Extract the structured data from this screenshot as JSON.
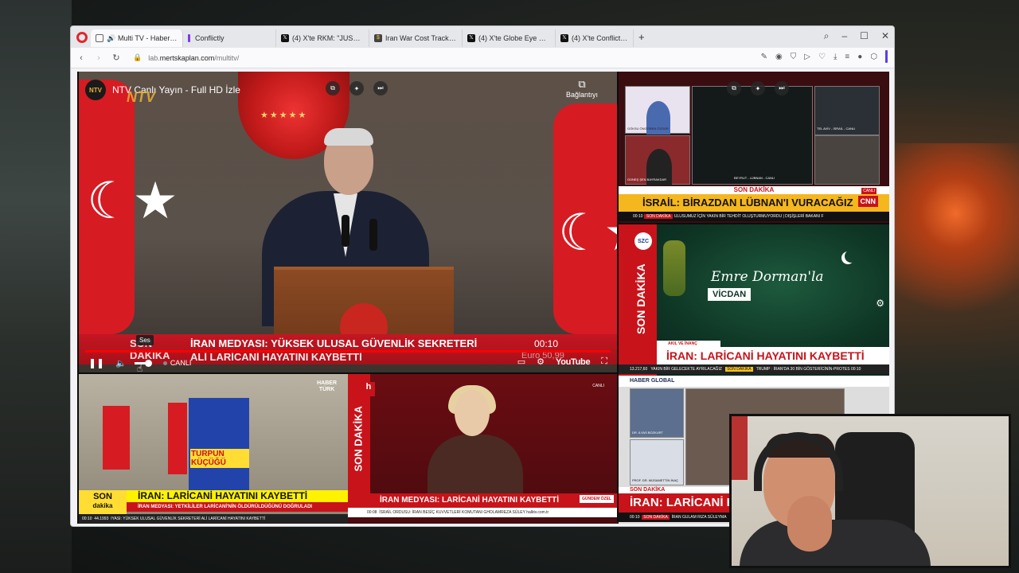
{
  "browser": {
    "tabs": [
      {
        "label": "Multi TV - Haber kanalları",
        "icon": "multitv-icon",
        "active": true
      },
      {
        "label": "Conflictly",
        "icon": "conflictly-icon"
      },
      {
        "label": "(4) X'te RKM: \"JUST IN",
        "icon": "x-icon"
      },
      {
        "label": "Iran War Cost Tracker — I",
        "icon": "tracker-icon"
      },
      {
        "label": "(4) X'te Globe Eye News: \"",
        "icon": "x-icon"
      },
      {
        "label": "(4) X'te Conflict: \"🔴 İsveç",
        "icon": "x-icon"
      }
    ],
    "url_host": "lab.mertskaplan.com",
    "url_path": "/multitv/",
    "url_prefix": "lab."
  },
  "main_player": {
    "channel_logo": "NTV",
    "title": "NTV Canlı Yayın - Full HD İzle",
    "watermark": "NTV",
    "share_label": "Bağlantıyı",
    "ticker_son": "SON DAKİKA",
    "ticker_line1": "İRAN MEDYASI: YÜKSEK ULUSAL GÜVENLİK SEKRETERİ",
    "ticker_line2": "ALİ LARİCANİ HAYATINI KAYBETTİ",
    "clock": "00:10",
    "euro": "Euro  50,99",
    "tooltip": "Ses",
    "live_label": "CANLI",
    "youtube_label": "YouTube"
  },
  "cnn_turk": {
    "son_dakika": "SON DAKİKA",
    "headline": "İSRAİL: BİRAZDAN LÜBNAN'I VURACAĞIZ",
    "logo": "CNN",
    "live": "CANLI",
    "ticker_time": "00:10",
    "ticker_tag": "SON DAKİKA",
    "ticker_text": "ULUSUMUZ İÇİN YAKIN BİR TEHDİT OLUŞTURMUYORDU  |  DIŞİŞLERİ BAKANI F",
    "tile_labels": [
      "GÖKSU ÖNGÖREN ÖZGÜR",
      "GÜNEŞ ŞEN BAYRAKDAR",
      "BEYRUT - LÜBNAN - CANLI",
      "TEL AVİV - İSRAİL - CANLI"
    ]
  },
  "sozcu": {
    "logo": "SZC",
    "vertical": "SON DAKİKA",
    "script_title": "Emre Dorman'la",
    "banner": "VİCDAN",
    "sub": "AKIL VE İNANÇ",
    "headline": "İRAN: LARİCANİ HAYATINI KAYBETTİ",
    "ticker_views": "13.217,60",
    "ticker_text": "YAKIN BİR GELECEKTE AYRILACAĞIZ",
    "ticker_tag": "SON DAKİKA",
    "ticker_text2": "TRUMP : İRAN'DA 30 BİN GÖSTERİCİNİN-PROTES",
    "ticker_time": "00:10"
  },
  "haber_global": {
    "logo": "HABER GLOBAL",
    "guest1": "DR. İLYAS BOZKURT",
    "guest2": "PROF. DR. MÜSAMETTİN İNAÇ",
    "son": "SON DAKİKA",
    "headline": "İRAN: LARİCANİ HA",
    "ticker_time": "00:10",
    "ticker_tag": "SON DAKİKA",
    "ticker_text": "İRAN GULAM RIZA SÜLEYMA"
  },
  "haberturk": {
    "logo_line1": "HABER",
    "logo_line2": "TÜRK",
    "poster_text": "TURPUN KÜÇÜĞÜ",
    "son": "SON",
    "dakika": "dakika",
    "headline": "İRAN: LARİCANİ HAYATINI KAYBETTİ",
    "sub": "İRAN MEDYASI: YETKİLİLER LARİCANİ'NİN ÖLDÜRÜLDÜĞÜNÜ DOĞRULADI",
    "ticker_time": "00:10",
    "ticker_value": "44.1993",
    "ticker_text": "IYASI: YÜKSEK ULUSAL GÜVENLİK SEKRETERİ ALİ LARİCANİ HAYATINI KAYBETTİ"
  },
  "halk_tv": {
    "logo": "h",
    "vertical": "SON DAKİKA",
    "live": "CANLI",
    "headline": "İRAN MEDYASI: LARİCANİ HAYATINI KAYBETTİ",
    "program": "GÜNDEM ÖZEL",
    "ticker_time": "00:08",
    "ticker_text": "İSRAİL ORDUSU: İRAN BESİÇ KUVVETLERİ KOMUTANI GHOLAMREZA SÜLEY  halktv.com.tr"
  },
  "colors": {
    "accent_red": "#c8131a",
    "progress_red": "#ff0000",
    "opera_red": "#e0262b",
    "ht_yellow": "#fff200"
  }
}
